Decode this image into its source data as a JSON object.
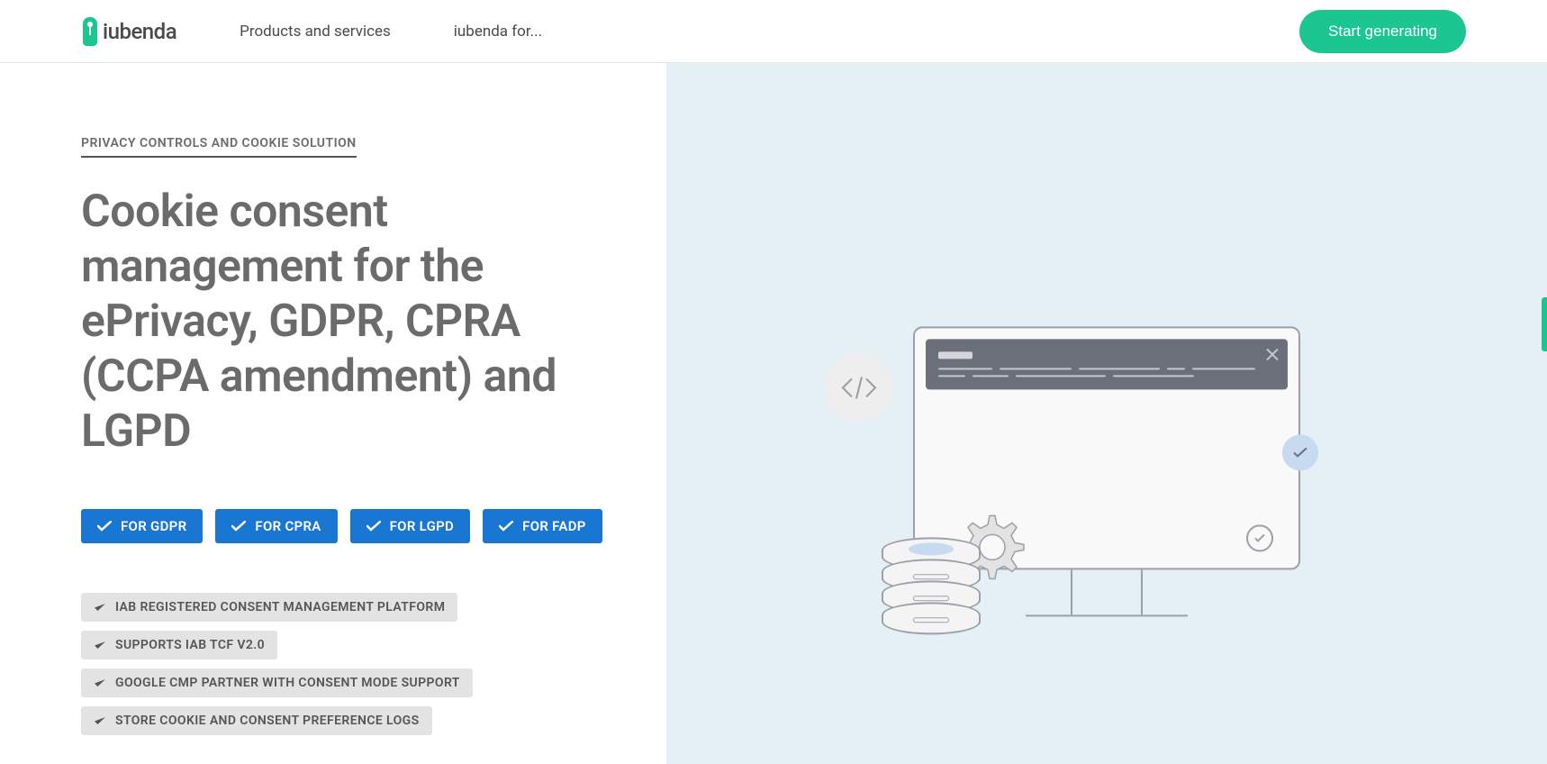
{
  "header": {
    "brand": "iubenda",
    "nav": {
      "products": "Products and services",
      "iubenda_for": "iubenda for..."
    },
    "cta": "Start generating"
  },
  "hero": {
    "eyebrow": "PRIVACY CONTROLS AND COOKIE SOLUTION",
    "heading": "Cookie consent management for the ePrivacy, GDPR, CPRA (CCPA amendment) and LGPD",
    "badges": [
      {
        "label": "FOR GDPR"
      },
      {
        "label": "FOR CPRA"
      },
      {
        "label": "FOR LGPD"
      },
      {
        "label": "FOR FADP"
      }
    ],
    "features": [
      {
        "label": "IAB REGISTERED CONSENT MANAGEMENT PLATFORM"
      },
      {
        "label": "SUPPORTS IAB TCF V2.0"
      },
      {
        "label": "GOOGLE CMP PARTNER WITH CONSENT MODE SUPPORT"
      },
      {
        "label": "STORE COOKIE AND CONSENT PREFERENCE LOGS"
      }
    ]
  },
  "colors": {
    "accent": "#1cc691",
    "badge_bg": "#1976d2",
    "illustration_bg": "#e4f0f6"
  }
}
